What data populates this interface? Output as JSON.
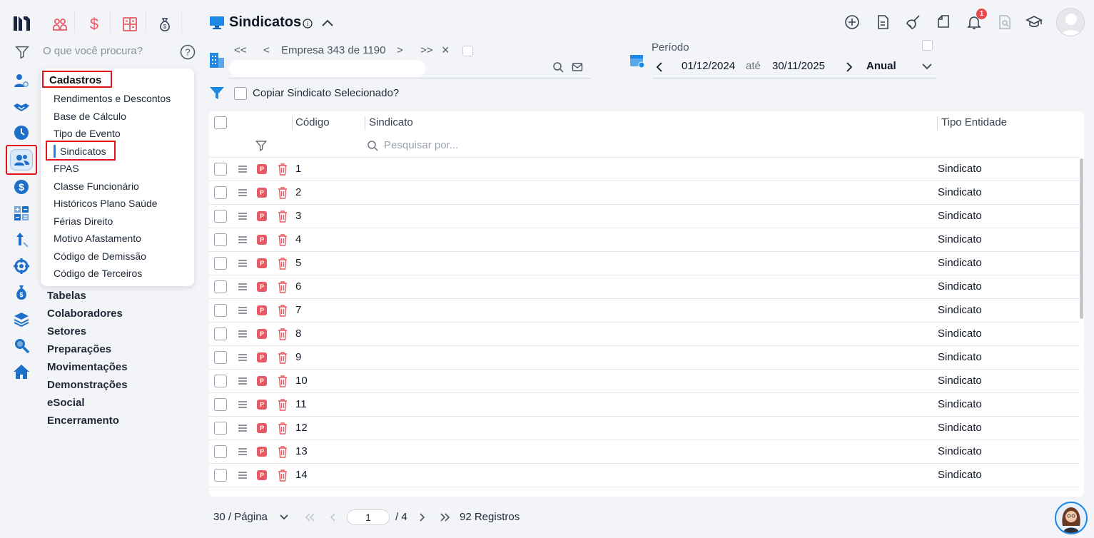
{
  "app": {
    "logo": "m-logo"
  },
  "top_shortcuts": [
    {
      "icon": "users-icon"
    },
    {
      "icon": "dollar-icon"
    },
    {
      "icon": "calculator-icon"
    },
    {
      "icon": "money-bag-icon"
    }
  ],
  "search": {
    "placeholder": "O que você procura?",
    "help": "?"
  },
  "rail_icons": [
    "user-gear-icon",
    "handshake-icon",
    "clock-icon",
    "people-icon",
    "dollar-circle-icon",
    "calculator-icon",
    "growth-icon",
    "gear-network-icon",
    "money-bag-icon",
    "layers-icon",
    "magnifier-icon",
    "home-icon"
  ],
  "menu": {
    "section": "Cadastros",
    "sub_items": [
      "Rendimentos e Descontos",
      "Base de Cálculo",
      "Tipo de Evento",
      "Sindicatos",
      "FPAS",
      "Classe Funcionário",
      "Históricos Plano Saúde",
      "Férias Direito",
      "Motivo Afastamento",
      "Código de Demissão",
      "Código de Terceiros"
    ],
    "main_items": [
      "Tabelas",
      "Colaboradores",
      "Setores",
      "Preparações",
      "Movimentações",
      "Demonstrações",
      "eSocial",
      "Encerramento"
    ]
  },
  "header": {
    "title": "Sindicatos",
    "info_icon": "i",
    "notification_count": "1"
  },
  "company_nav": {
    "first": "<<",
    "prev": "<",
    "label": "Empresa 343 de 1190",
    "next": ">",
    "last": ">>",
    "close": "×"
  },
  "period": {
    "label": "Período",
    "start": "01/12/2024",
    "sep": "até",
    "end": "30/11/2025",
    "mode": "Anual"
  },
  "copy_option": {
    "label": "Copiar Sindicato Selecionado?"
  },
  "table": {
    "columns": [
      "Código",
      "Sindicato",
      "Tipo Entidade"
    ],
    "filter_placeholder": "Pesquisar por...",
    "badge": "P",
    "rows": [
      {
        "code": "1",
        "sindicato": "",
        "tipo": "Sindicato"
      },
      {
        "code": "2",
        "sindicato": "",
        "tipo": "Sindicato"
      },
      {
        "code": "3",
        "sindicato": "",
        "tipo": "Sindicato"
      },
      {
        "code": "4",
        "sindicato": "",
        "tipo": "Sindicato"
      },
      {
        "code": "5",
        "sindicato": "",
        "tipo": "Sindicato"
      },
      {
        "code": "6",
        "sindicato": "",
        "tipo": "Sindicato"
      },
      {
        "code": "7",
        "sindicato": "",
        "tipo": "Sindicato"
      },
      {
        "code": "8",
        "sindicato": "",
        "tipo": "Sindicato"
      },
      {
        "code": "9",
        "sindicato": "",
        "tipo": "Sindicato"
      },
      {
        "code": "10",
        "sindicato": "",
        "tipo": "Sindicato"
      },
      {
        "code": "11",
        "sindicato": "",
        "tipo": "Sindicato"
      },
      {
        "code": "12",
        "sindicato": "",
        "tipo": "Sindicato"
      },
      {
        "code": "13",
        "sindicato": "",
        "tipo": "Sindicato"
      },
      {
        "code": "14",
        "sindicato": "",
        "tipo": "Sindicato"
      }
    ]
  },
  "pagination": {
    "per_page": "30 / Página",
    "current_page": "1",
    "total_pages": "/ 4",
    "records": "92 Registros"
  },
  "colors": {
    "accent": "#1e88e5",
    "danger": "#e3131b",
    "badge": "#e85a63"
  }
}
